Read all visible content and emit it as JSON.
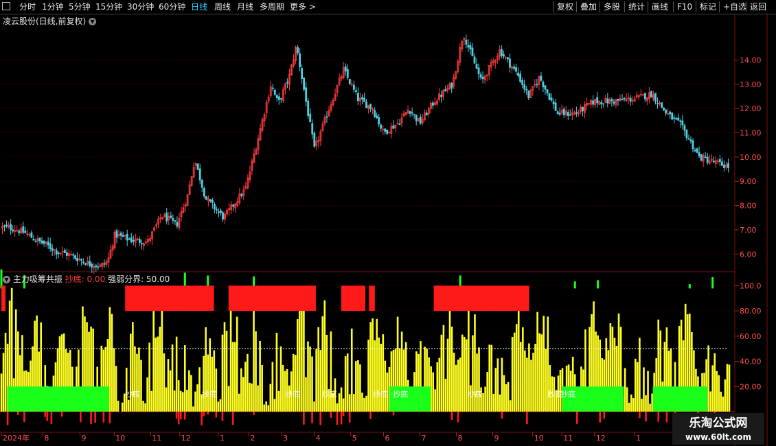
{
  "toolbar": {
    "periods": [
      "分时",
      "1分钟",
      "5分钟",
      "15分钟",
      "30分钟",
      "60分钟",
      "日线",
      "周线",
      "月线",
      "多周期",
      "更多 >"
    ],
    "active_period": "日线",
    "right_buttons": [
      "复权",
      "叠加",
      "多股",
      "统计",
      "画线",
      "F10",
      "标记",
      "+自选",
      "返回"
    ]
  },
  "main_chart": {
    "title": "凌云股份(日线,前复权)",
    "price_ticks": [
      "14.00",
      "13.00",
      "12.00",
      "11.00",
      "10.00",
      "9.00",
      "8.00",
      "7.00",
      "6.00"
    ]
  },
  "indicator": {
    "name": "主力吸筹共振",
    "label1": "抄底: 0.00",
    "label2": "强弱分界: 50.00",
    "y_ticks": [
      "100.0",
      "80.00",
      "60.00",
      "40.00",
      "20.00"
    ],
    "signal_text": "抄底"
  },
  "time_axis": {
    "labels": [
      "2024年",
      "8",
      "9",
      "10",
      "11",
      "12",
      "1",
      "2",
      "3",
      "4",
      "5",
      "6",
      "7",
      "8",
      "9",
      "10",
      "11",
      "12",
      "1"
    ]
  },
  "watermark": {
    "line1": "乐淘公式网",
    "line2": "www.60lt.com"
  },
  "colors": {
    "up": "#ff3b3b",
    "down": "#4fd1e5",
    "yellow": "#ffff22",
    "green": "#1aff1a",
    "red": "#ff1a1a",
    "grid": "#5a0000"
  },
  "chart_data": {
    "type": "candlestick",
    "title": "凌云股份(日线,前复权)",
    "ylim": [
      5.3,
      15.4
    ],
    "yticks": [
      6,
      7,
      8,
      9,
      10,
      11,
      12,
      13,
      14
    ],
    "close_path": [
      [
        0,
        7.1
      ],
      [
        0.01,
        7.1
      ],
      [
        0.03,
        6.9
      ],
      [
        0.045,
        6.6
      ],
      [
        0.06,
        6.4
      ],
      [
        0.075,
        6.1
      ],
      [
        0.09,
        6.0
      ],
      [
        0.105,
        5.8
      ],
      [
        0.12,
        5.6
      ],
      [
        0.135,
        5.5
      ],
      [
        0.145,
        5.7
      ],
      [
        0.155,
        6.8
      ],
      [
        0.175,
        6.6
      ],
      [
        0.2,
        6.5
      ],
      [
        0.22,
        7.6
      ],
      [
        0.24,
        7.2
      ],
      [
        0.255,
        8.4
      ],
      [
        0.265,
        9.9
      ],
      [
        0.28,
        8.3
      ],
      [
        0.305,
        7.5
      ],
      [
        0.335,
        8.7
      ],
      [
        0.35,
        10.5
      ],
      [
        0.37,
        13.0
      ],
      [
        0.38,
        12.2
      ],
      [
        0.395,
        13.3
      ],
      [
        0.405,
        14.6
      ],
      [
        0.42,
        12.0
      ],
      [
        0.43,
        10.3
      ],
      [
        0.45,
        12.0
      ],
      [
        0.47,
        13.6
      ],
      [
        0.49,
        12.4
      ],
      [
        0.51,
        12.0
      ],
      [
        0.525,
        11.0
      ],
      [
        0.545,
        11.4
      ],
      [
        0.56,
        12.0
      ],
      [
        0.575,
        11.4
      ],
      [
        0.595,
        12.3
      ],
      [
        0.62,
        13.0
      ],
      [
        0.635,
        15.1
      ],
      [
        0.66,
        13.1
      ],
      [
        0.685,
        14.4
      ],
      [
        0.71,
        13.4
      ],
      [
        0.725,
        12.5
      ],
      [
        0.74,
        13.3
      ],
      [
        0.765,
        11.8
      ],
      [
        0.79,
        11.8
      ],
      [
        0.815,
        12.3
      ],
      [
        0.84,
        12.3
      ],
      [
        0.87,
        12.4
      ],
      [
        0.895,
        12.6
      ],
      [
        0.915,
        11.8
      ],
      [
        0.935,
        11.3
      ],
      [
        0.96,
        10.0
      ],
      [
        1.0,
        9.6
      ]
    ],
    "indicator_series": {
      "name": "主力吸筹共振",
      "ylim": [
        0,
        110
      ],
      "divider": 50,
      "red_zones": [
        [
          0.17,
          0.292
        ],
        [
          0.312,
          0.432
        ],
        [
          0.467,
          0.5
        ],
        [
          0.505,
          0.513
        ],
        [
          0.594,
          0.725
        ]
      ],
      "green_zones": [
        [
          0.008,
          0.148
        ],
        [
          0.533,
          0.59
        ],
        [
          0.77,
          0.855
        ],
        [
          0.895,
          0.97
        ]
      ]
    }
  }
}
